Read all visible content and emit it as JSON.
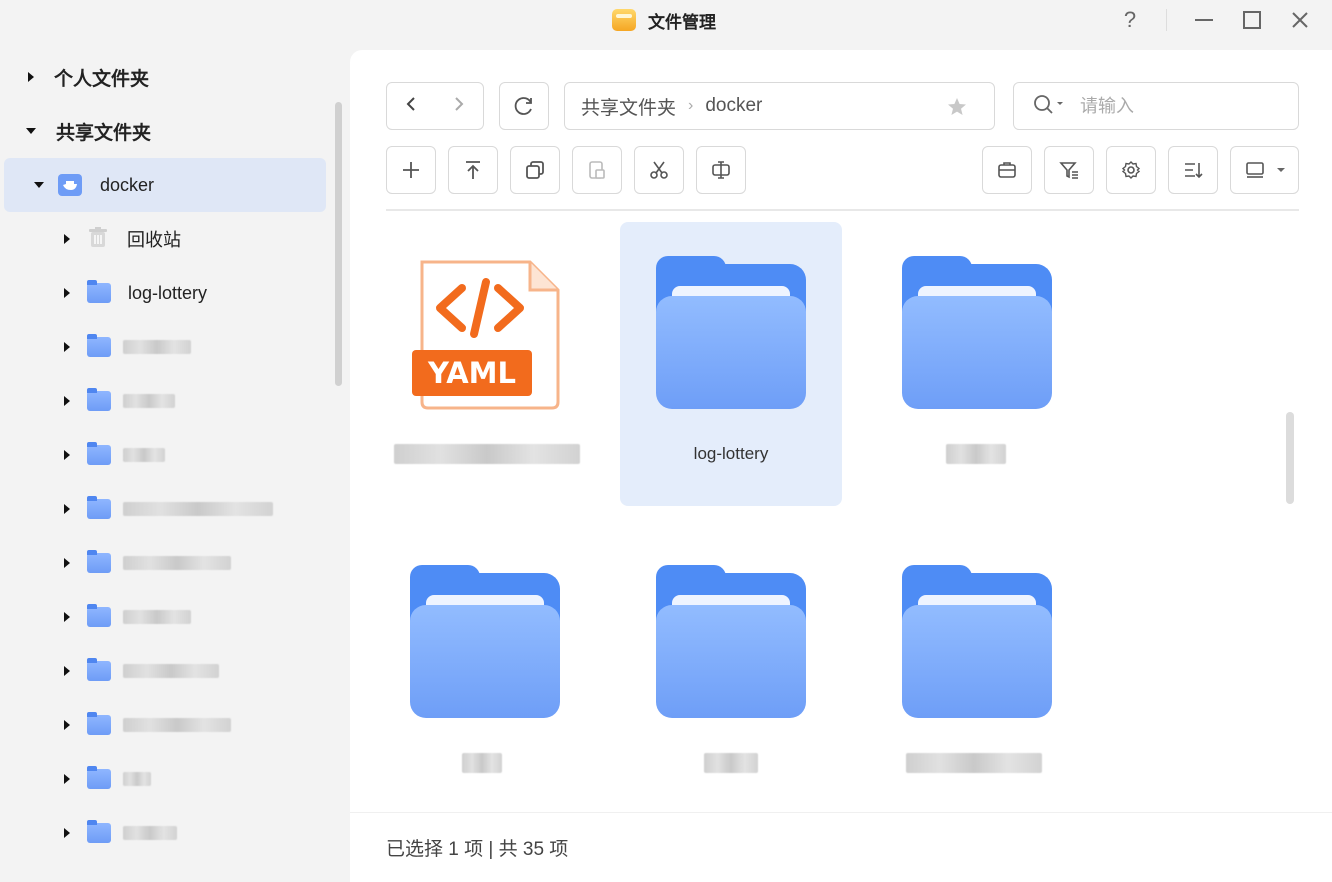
{
  "window": {
    "title": "文件管理",
    "help": "?"
  },
  "sidebar": {
    "personal": "个人文件夹",
    "shared": "共享文件夹",
    "docker": "docker",
    "children": [
      {
        "label": "回收站",
        "icon": "trash-icon"
      },
      {
        "label": "log-lottery",
        "icon": "folder-icon"
      },
      {
        "label": "",
        "icon": "folder-icon"
      },
      {
        "label": "",
        "icon": "folder-icon"
      },
      {
        "label": "",
        "icon": "folder-icon"
      },
      {
        "label": "",
        "icon": "folder-icon"
      },
      {
        "label": "",
        "icon": "folder-icon"
      },
      {
        "label": "",
        "icon": "folder-icon"
      },
      {
        "label": "",
        "icon": "folder-icon"
      },
      {
        "label": "",
        "icon": "folder-icon"
      },
      {
        "label": "",
        "icon": "folder-icon"
      },
      {
        "label": "",
        "icon": "folder-icon"
      }
    ]
  },
  "toolbar": {
    "breadcrumb": [
      "共享文件夹",
      "docker"
    ],
    "search_placeholder": "请输入"
  },
  "grid": {
    "items": [
      {
        "name": "",
        "type": "yaml-file",
        "badge": "YAML"
      },
      {
        "name": "log-lottery",
        "type": "folder",
        "selected": true
      },
      {
        "name": "",
        "type": "folder"
      },
      {
        "name": "",
        "type": "folder"
      },
      {
        "name": "",
        "type": "folder"
      },
      {
        "name": "",
        "type": "folder"
      }
    ]
  },
  "status": {
    "text": "已选择 1 项 | 共 35 项"
  },
  "colors": {
    "accent": "#4e8cf5",
    "selected_bg": "#e4edfb",
    "yaml_orange": "#f26b1d"
  }
}
